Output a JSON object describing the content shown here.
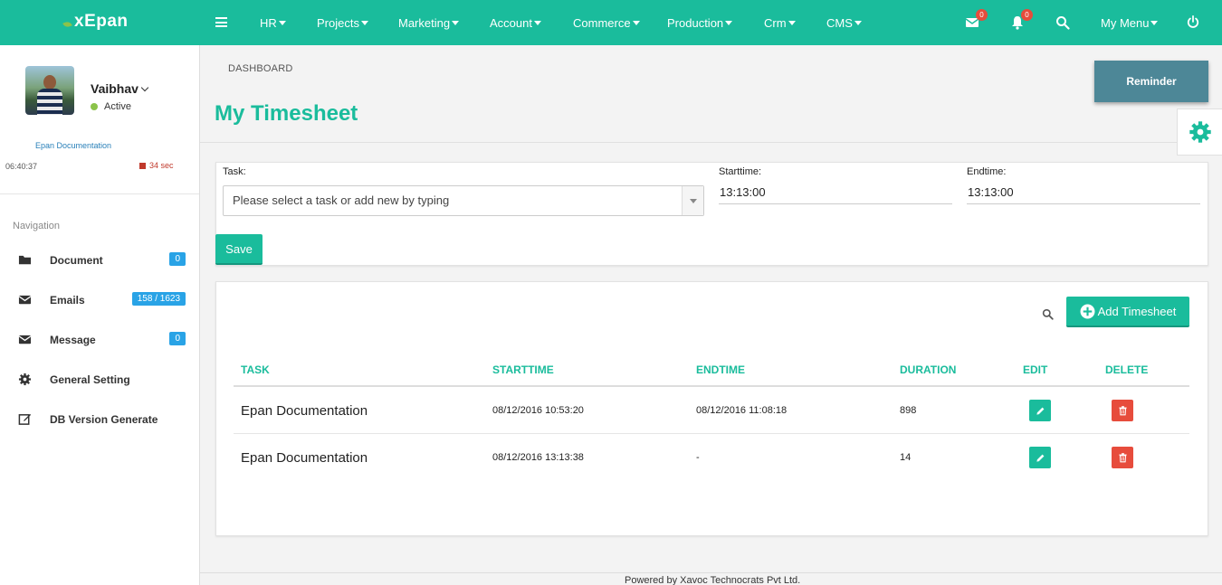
{
  "brand": {
    "name": "xEpan"
  },
  "topnav": {
    "items": [
      {
        "label": "HR"
      },
      {
        "label": "Projects"
      },
      {
        "label": "Marketing"
      },
      {
        "label": "Account"
      },
      {
        "label": "Commerce"
      },
      {
        "label": "Production"
      },
      {
        "label": "Crm"
      },
      {
        "label": "CMS"
      }
    ],
    "mail_count": "0",
    "notif_count": "0",
    "my_menu": "My Menu"
  },
  "user": {
    "name": "Vaibhav",
    "status": "Active",
    "current_task": "Epan Documentation",
    "clock": "06:40:37",
    "elapsed": "34 sec"
  },
  "sidebar": {
    "nav_title": "Navigation",
    "items": [
      {
        "label": "Document",
        "icon": "folder-icon",
        "count": "0"
      },
      {
        "label": "Emails",
        "icon": "envelope-icon",
        "count": "158 / 1623"
      },
      {
        "label": "Message",
        "icon": "envelope-icon",
        "count": "0"
      },
      {
        "label": "General Setting",
        "icon": "gear-icon",
        "count": ""
      },
      {
        "label": "DB Version Generate",
        "icon": "edit-icon",
        "count": ""
      }
    ]
  },
  "page": {
    "breadcrumb": "DASHBOARD",
    "title": "My Timesheet",
    "reminder_label": "Reminder"
  },
  "form": {
    "task_label": "Task:",
    "task_placeholder": "Please select a task or add new by typing",
    "start_label": "Starttime:",
    "start_value": "13:13:00",
    "end_label": "Endtime:",
    "end_value": "13:13:00",
    "save_label": "Save"
  },
  "table": {
    "add_label": "Add Timesheet",
    "headers": [
      "TASK",
      "STARTTIME",
      "ENDTIME",
      "DURATION",
      "EDIT",
      "DELETE"
    ],
    "rows": [
      {
        "task": "Epan Documentation",
        "start": "08/12/2016 10:53:20",
        "end": "08/12/2016 11:08:18",
        "duration": "898"
      },
      {
        "task": "Epan Documentation",
        "start": "08/12/2016 13:13:38",
        "end": "-",
        "duration": "14"
      }
    ]
  },
  "footer": {
    "text": "Powered by Xavoc Technocrats Pvt Ltd."
  },
  "colors": {
    "accent": "#1abc9c",
    "danger": "#e74c3c",
    "info": "#29a3e6",
    "reminder": "#4d8797"
  }
}
